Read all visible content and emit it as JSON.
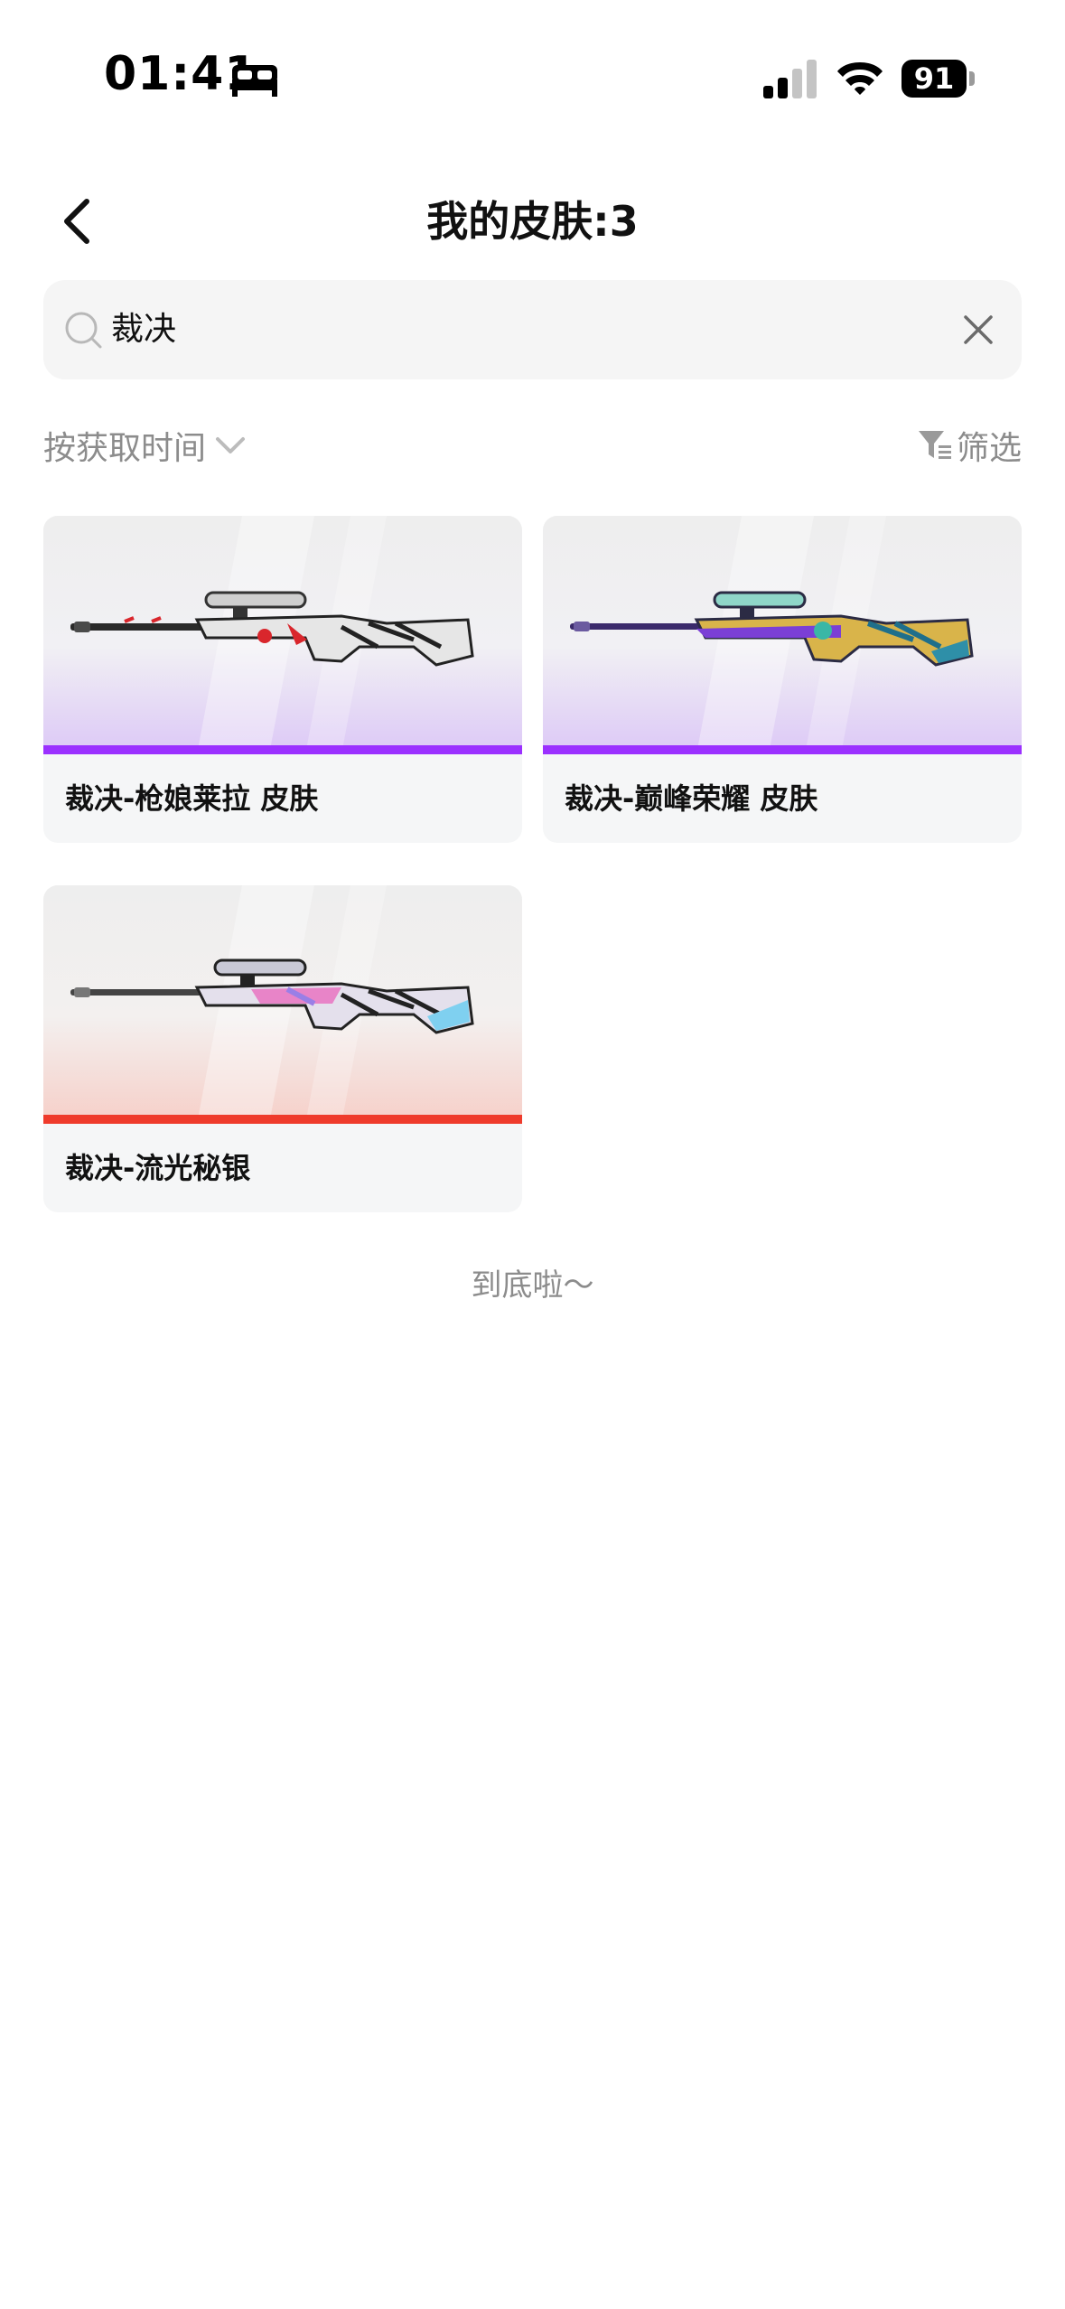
{
  "status_bar": {
    "time": "01:41",
    "battery": "91",
    "icons": [
      "bed-icon",
      "cellular-signal-icon",
      "wifi-icon",
      "battery-icon"
    ]
  },
  "header": {
    "title": "我的皮肤:3",
    "back_icon": "chevron-left-icon"
  },
  "search": {
    "value": "裁决",
    "icon": "search-icon",
    "clear_icon": "close-icon"
  },
  "sort": {
    "label": "按获取时间",
    "icon": "chevron-down-icon"
  },
  "filter": {
    "label": "筛选",
    "icon": "filter-icon"
  },
  "colors": {
    "purple_rarity": "#9b30ff",
    "red_rarity": "#ef3b2c",
    "card_bg": "#f5f6f7",
    "muted_text": "#8c8c8c"
  },
  "skins": [
    {
      "name": "裁决-枪娘莱拉 皮肤",
      "rarity_color": "#9b30ff",
      "icon": "sniper-rifle-image"
    },
    {
      "name": "裁决-巅峰荣耀 皮肤",
      "rarity_color": "#9b30ff",
      "icon": "sniper-rifle-image"
    },
    {
      "name": "裁决-流光秘银",
      "rarity_color": "#ef3b2c",
      "icon": "sniper-rifle-image"
    }
  ],
  "footer": {
    "end_text": "到底啦～"
  }
}
